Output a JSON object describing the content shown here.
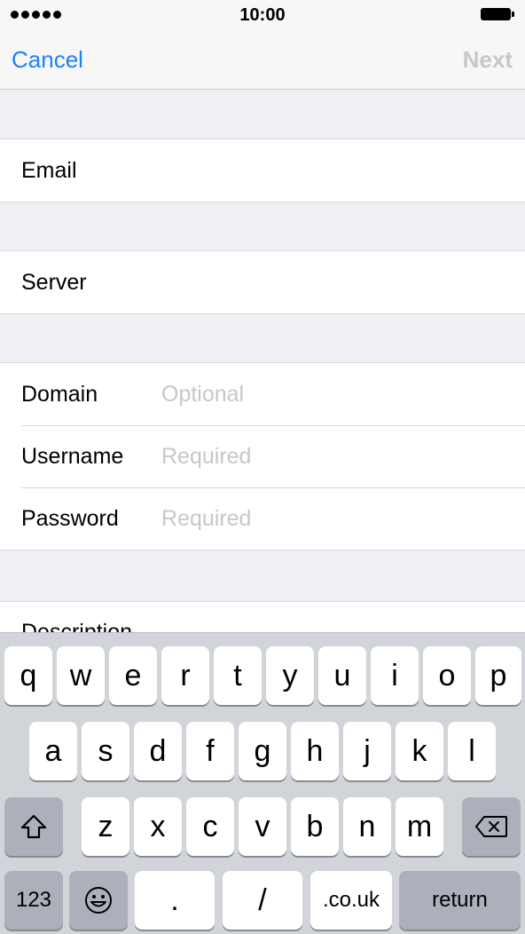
{
  "status_bar": {
    "time": "10:00"
  },
  "nav": {
    "cancel": "Cancel",
    "next": "Next"
  },
  "form": {
    "email": {
      "label": "Email"
    },
    "server": {
      "label": "Server"
    },
    "domain": {
      "label": "Domain",
      "placeholder": "Optional"
    },
    "username": {
      "label": "Username",
      "placeholder": "Required"
    },
    "password": {
      "label": "Password",
      "placeholder": "Required"
    },
    "description": {
      "label": "Description"
    }
  },
  "keyboard": {
    "row1": [
      "q",
      "w",
      "e",
      "r",
      "t",
      "y",
      "u",
      "i",
      "o",
      "p"
    ],
    "row2": [
      "a",
      "s",
      "d",
      "f",
      "g",
      "h",
      "j",
      "k",
      "l"
    ],
    "row3": [
      "z",
      "x",
      "c",
      "v",
      "b",
      "n",
      "m"
    ],
    "numbers": "123",
    "dot": ".",
    "slash": "/",
    "couk": ".co.uk",
    "return": "return",
    "icons": {
      "shift": "shift-icon",
      "delete": "delete-icon",
      "emoji": "emoji-icon"
    }
  }
}
